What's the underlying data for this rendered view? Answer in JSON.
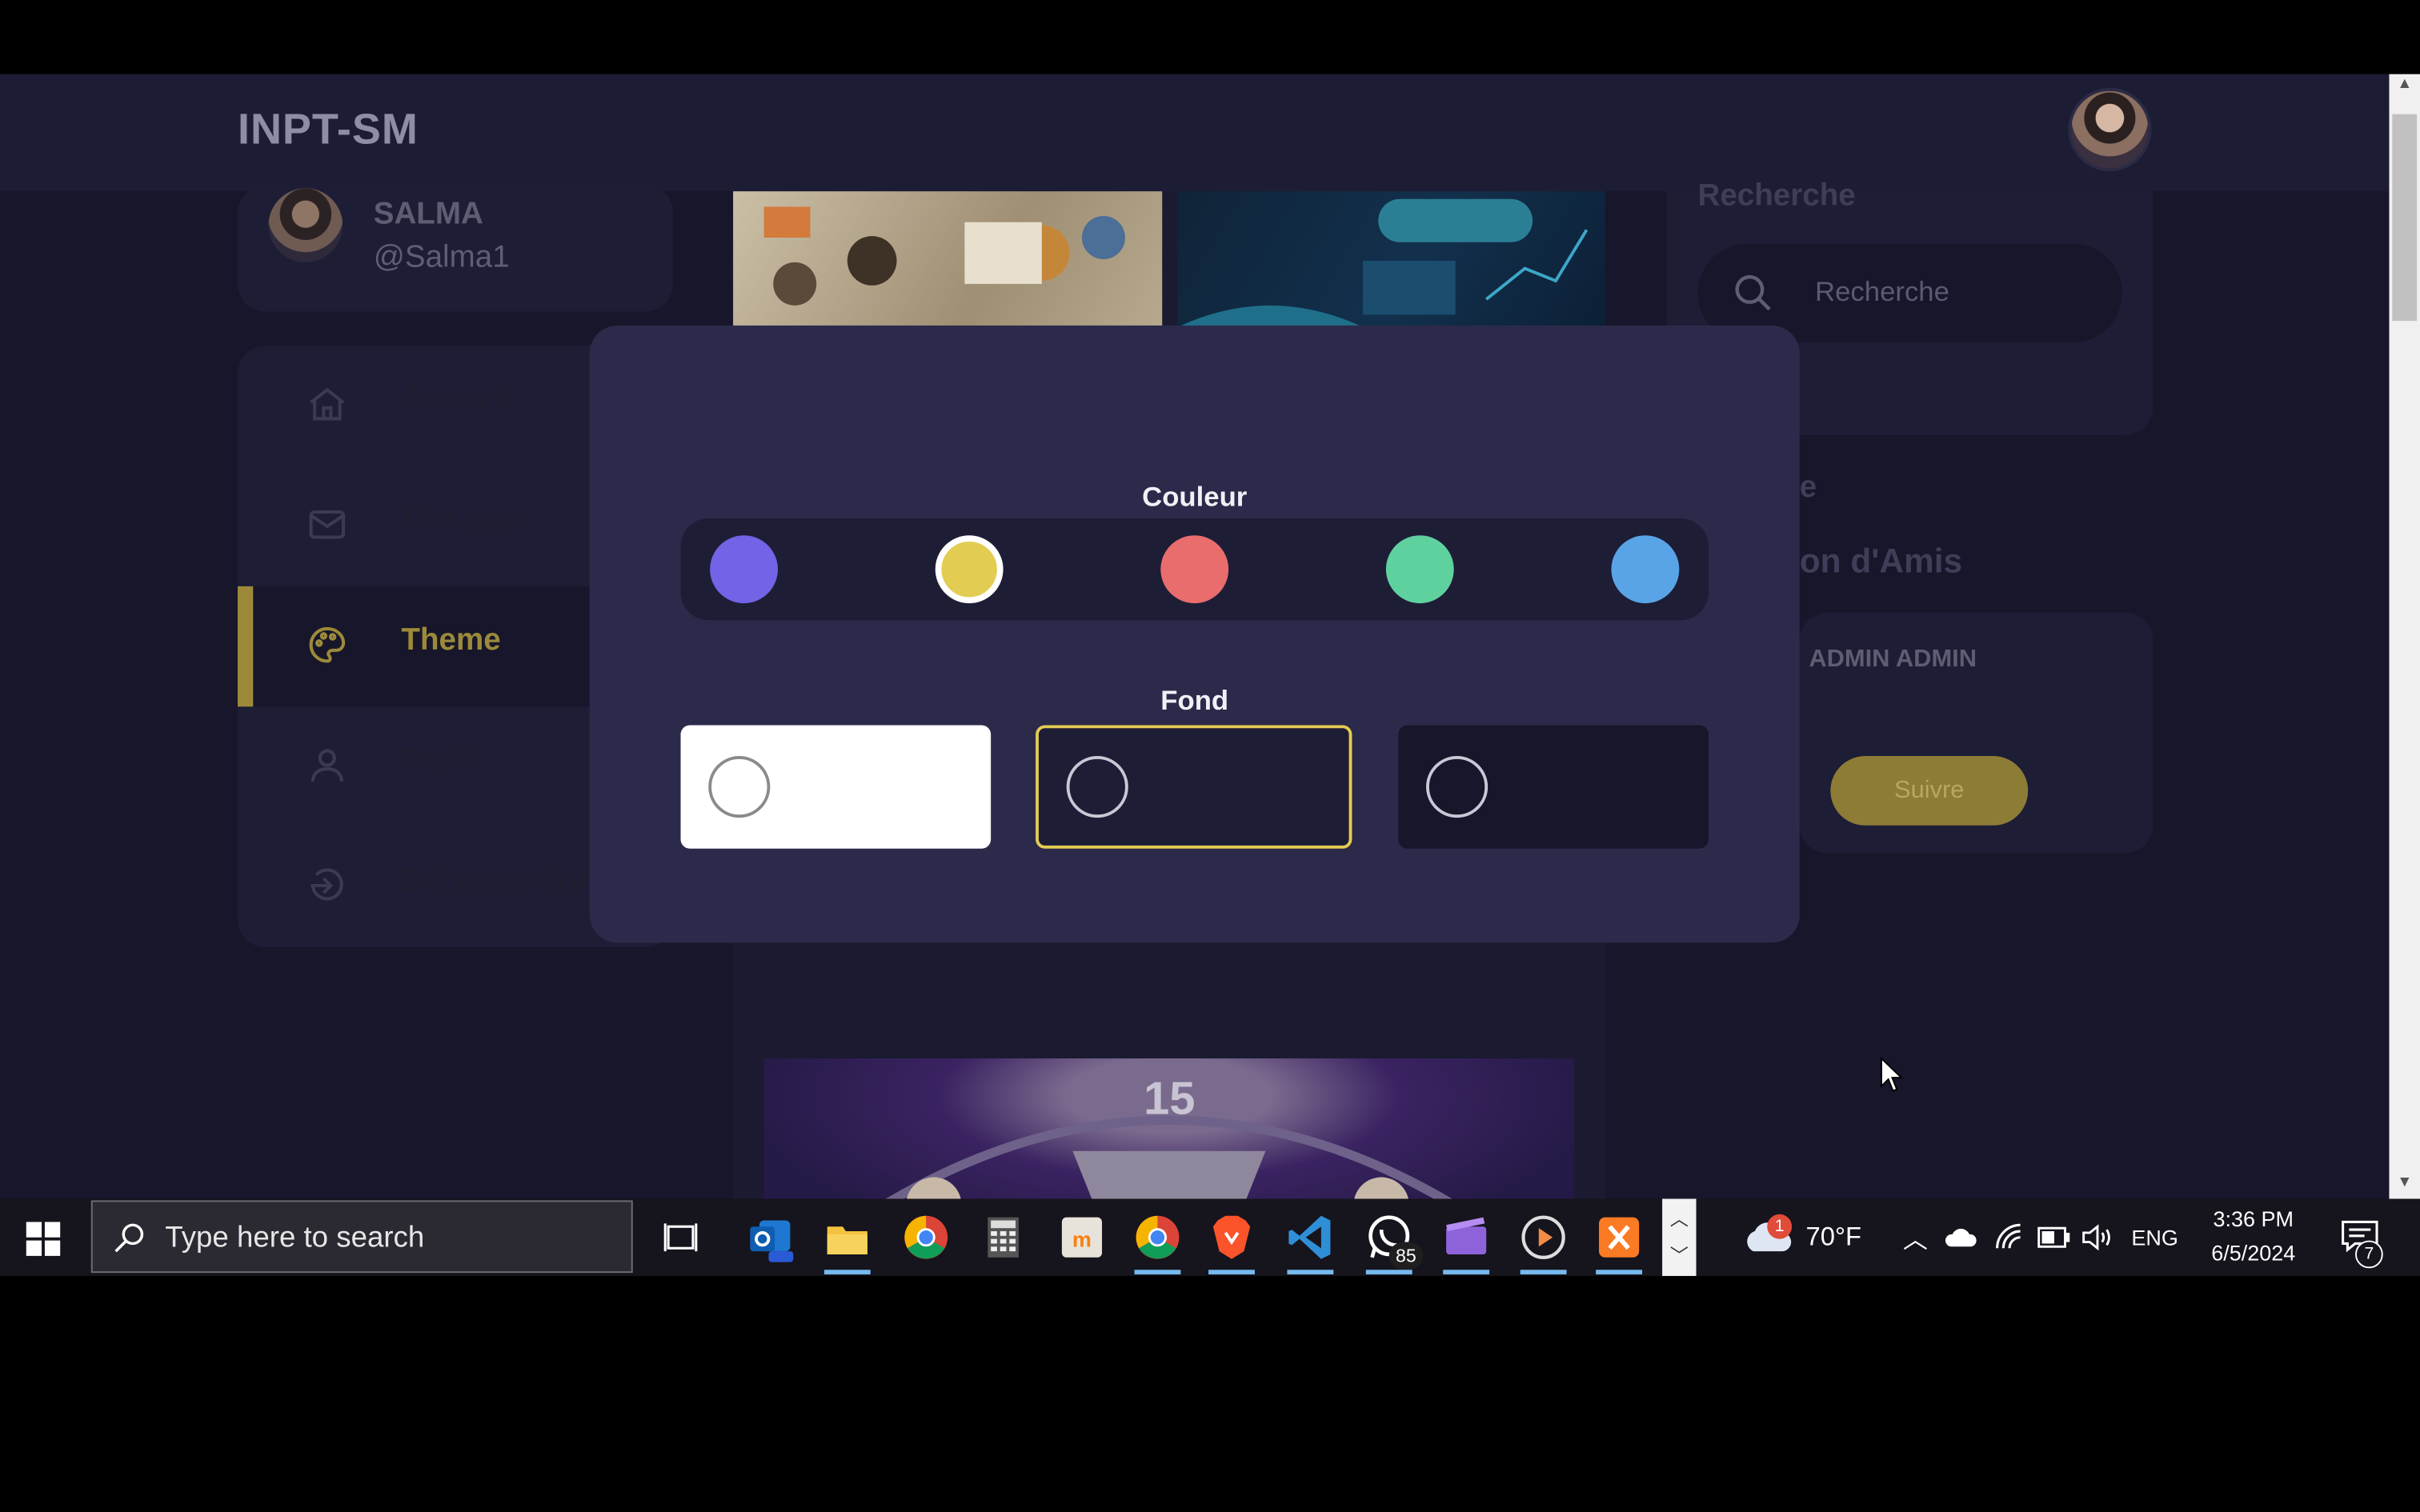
{
  "app": {
    "logo": "INPT-SM"
  },
  "profile": {
    "name": "SALMA",
    "handle": "@Salma1"
  },
  "menu": {
    "items": [
      {
        "label": "Accueil",
        "icon": "home-icon",
        "active": false
      },
      {
        "label": "Message",
        "icon": "mail-icon",
        "active": false
      },
      {
        "label": "Theme",
        "icon": "palette-icon",
        "active": true
      },
      {
        "label": "Profil",
        "icon": "user-icon",
        "active": false
      },
      {
        "label": "Déconnexion",
        "icon": "logout-icon",
        "active": false
      }
    ]
  },
  "feed": {
    "trophy_number": "15"
  },
  "right": {
    "title": "Recherche",
    "search_placeholder": "Recherche",
    "section_label": "e",
    "suggestions_label": "on d'Amis",
    "friend_name": "ADMIN ADMIN",
    "follow_label": "Suivre"
  },
  "theme_modal": {
    "color_heading": "Couleur",
    "background_heading": "Fond",
    "colors": [
      {
        "name": "purple",
        "hex": "#7363e6",
        "selected": false
      },
      {
        "name": "yellow",
        "hex": "#e3cc52",
        "selected": true
      },
      {
        "name": "red",
        "hex": "#e96d6d",
        "selected": false
      },
      {
        "name": "green",
        "hex": "#5fd19f",
        "selected": false
      },
      {
        "name": "blue",
        "hex": "#58a4e6",
        "selected": false
      }
    ],
    "backgrounds": [
      {
        "name": "light",
        "hex": "#ffffff",
        "selected": false
      },
      {
        "name": "dim",
        "hex": "#1e1d36",
        "selected": true
      },
      {
        "name": "dark",
        "hex": "#17162a",
        "selected": false
      }
    ]
  },
  "taskbar": {
    "search_placeholder": "Type here to search",
    "whatsapp_badge": "85",
    "weather_alert": "1",
    "temperature": "70°F",
    "language": "ENG",
    "time": "3:36 PM",
    "date": "6/5/2024",
    "notification_count": "7",
    "pinned_apps": [
      "task-view-icon",
      "outlook-new-icon",
      "file-explorer-icon",
      "chrome-icon",
      "calculator-icon",
      "moodle-icon",
      "chrome-profile-icon",
      "brave-icon",
      "vscode-icon",
      "whatsapp-icon",
      "clipchamp-icon",
      "media-player-icon",
      "xampp-icon"
    ]
  }
}
